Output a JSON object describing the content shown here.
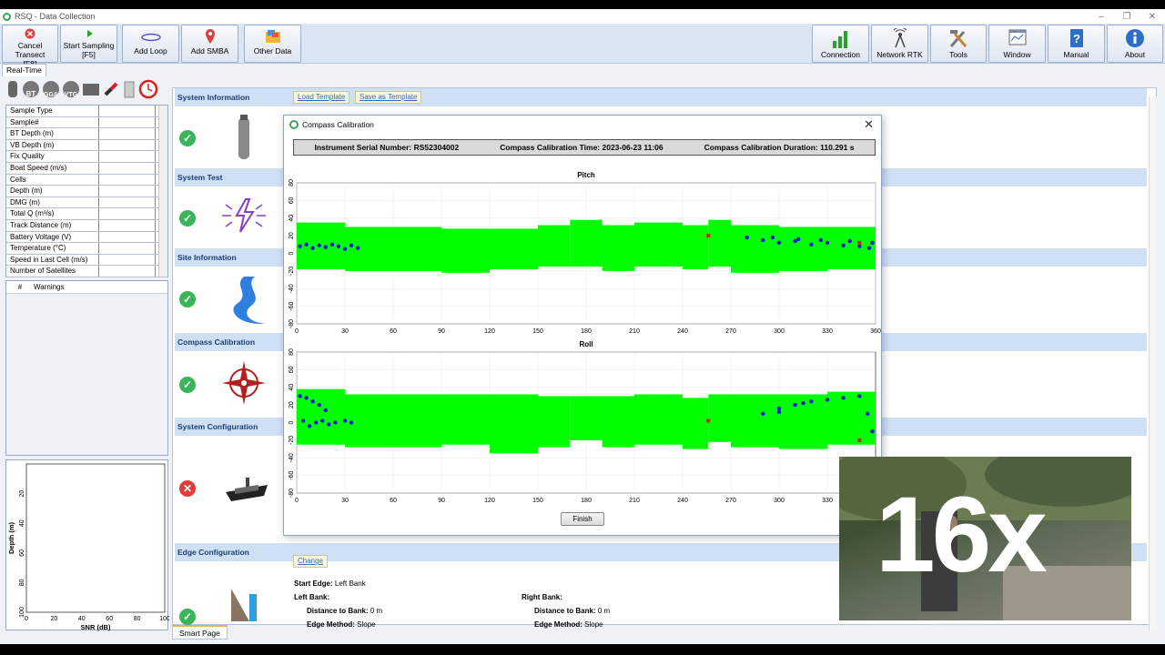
{
  "window": {
    "title": "RSQ - Data Collection"
  },
  "toolbar": {
    "left": [
      {
        "label": "Cancel Transect",
        "sub": "[F8]",
        "icon": "cancel-icon"
      },
      {
        "label": "Start Sampling",
        "sub": "[F5]",
        "icon": "play-icon"
      },
      {
        "label": "Add Loop",
        "sub": "",
        "icon": "loop-icon"
      },
      {
        "label": "Add SMBA",
        "sub": "",
        "icon": "pin-icon"
      },
      {
        "label": "Other Data",
        "sub": "",
        "icon": "folder-icon"
      }
    ],
    "right": [
      {
        "label": "Connection",
        "icon": "signal-bars-icon"
      },
      {
        "label": "Network RTK",
        "icon": "antenna-icon"
      },
      {
        "label": "Tools",
        "icon": "tools-icon"
      },
      {
        "label": "Window",
        "icon": "window-icon"
      },
      {
        "label": "Manual",
        "icon": "manual-icon"
      },
      {
        "label": "About",
        "icon": "info-icon"
      }
    ]
  },
  "tabs": {
    "realtime": "Real-Time",
    "smart_page": "Smart Page"
  },
  "left_icons": [
    "BT",
    "GGA",
    "VTG"
  ],
  "data_table": [
    "Sample Type",
    "Sample#",
    "BT Depth (m)",
    "VB Depth (m)",
    "Fix Quality",
    "Boat Speed (m/s)",
    "Cells",
    "Depth (m)",
    "DMG (m)",
    "Total Q (m³/s)",
    "Track Distance (m)",
    "Battery Voltage (V)",
    "Temperature (°C)",
    "Speed in Last Cell (m/s)",
    "Number of Satellites"
  ],
  "warnings": {
    "col_num": "#",
    "col_label": "Warnings"
  },
  "snr_chart": {
    "xlabel": "SNR (dB)",
    "ylabel": "Depth (m)",
    "xticks": [
      "0",
      "20",
      "40",
      "60",
      "80",
      "100"
    ],
    "yticks": [
      "20",
      "40",
      "60",
      "80",
      "100"
    ]
  },
  "sections": {
    "system_information": "System Information",
    "load_template": "Load Template",
    "save_template": "Save as Template",
    "system_test": "System Test",
    "site_information": "Site Information",
    "compass_calibration": "Compass Calibration",
    "system_configuration": "System Configuration",
    "edge_configuration": "Edge Configuration",
    "change": "Change"
  },
  "edge": {
    "start_edge_label": "Start Edge:",
    "start_edge_value": "Left Bank",
    "left_bank": "Left Bank:",
    "right_bank": "Right Bank:",
    "distance_label": "Distance to Bank:",
    "left_distance": "0 m",
    "right_distance": "0 m",
    "method_label": "Edge Method:",
    "left_method": "Slope",
    "right_method": "Slope"
  },
  "dialog": {
    "title": "Compass Calibration",
    "serial": "Instrument Serial Number: RS52304002",
    "time": "Compass Calibration Time: 2023-06-23 11:06",
    "duration": "Compass Calibration Duration: 110.291 s",
    "finish": "Finish"
  },
  "chart_data": [
    {
      "type": "scatter",
      "title": "Pitch",
      "xlim": [
        0,
        360
      ],
      "ylim": [
        -80,
        80
      ],
      "xticks": [
        0,
        30,
        60,
        90,
        120,
        150,
        180,
        210,
        240,
        270,
        300,
        330,
        360
      ],
      "yticks": [
        80,
        60,
        40,
        20,
        0,
        -20,
        -40,
        -60,
        -80
      ],
      "band_color": "#00ff00",
      "point_color": "#1a1ad6",
      "marker_color": "#d62020",
      "band": [
        [
          0,
          -18,
          35
        ],
        [
          30,
          -20,
          30
        ],
        [
          60,
          -20,
          30
        ],
        [
          90,
          -22,
          28
        ],
        [
          120,
          -18,
          28
        ],
        [
          150,
          -15,
          32
        ],
        [
          170,
          -15,
          38
        ],
        [
          190,
          -20,
          32
        ],
        [
          210,
          -15,
          35
        ],
        [
          240,
          -18,
          32
        ],
        [
          256,
          -15,
          38
        ],
        [
          270,
          -22,
          32
        ],
        [
          300,
          -20,
          30
        ],
        [
          330,
          -18,
          30
        ],
        [
          360,
          -18,
          30
        ]
      ],
      "markers": [
        [
          256,
          20
        ],
        [
          350,
          12
        ]
      ],
      "points": [
        [
          2,
          8
        ],
        [
          6,
          10
        ],
        [
          10,
          6
        ],
        [
          14,
          9
        ],
        [
          18,
          7
        ],
        [
          22,
          10
        ],
        [
          26,
          8
        ],
        [
          30,
          5
        ],
        [
          34,
          9
        ],
        [
          38,
          6
        ],
        [
          280,
          18
        ],
        [
          290,
          15
        ],
        [
          300,
          12
        ],
        [
          310,
          14
        ],
        [
          320,
          10
        ],
        [
          330,
          12
        ],
        [
          340,
          9
        ],
        [
          350,
          8
        ],
        [
          356,
          6
        ],
        [
          358,
          12
        ],
        [
          296,
          18
        ],
        [
          312,
          16
        ],
        [
          326,
          15
        ],
        [
          344,
          14
        ]
      ]
    },
    {
      "type": "scatter",
      "title": "Roll",
      "xlim": [
        0,
        360
      ],
      "ylim": [
        -80,
        80
      ],
      "xticks": [
        0,
        30,
        60,
        90,
        120,
        150,
        180,
        210,
        240,
        270,
        300,
        330
      ],
      "yticks": [
        80,
        60,
        40,
        20,
        0,
        -20,
        -40,
        -60,
        -80
      ],
      "band_color": "#00ff00",
      "point_color": "#1a1ad6",
      "marker_color": "#d62020",
      "band": [
        [
          0,
          -25,
          38
        ],
        [
          30,
          -28,
          32
        ],
        [
          60,
          -28,
          32
        ],
        [
          90,
          -25,
          32
        ],
        [
          120,
          -35,
          32
        ],
        [
          150,
          -28,
          30
        ],
        [
          170,
          -20,
          30
        ],
        [
          190,
          -28,
          30
        ],
        [
          210,
          -25,
          32
        ],
        [
          240,
          -30,
          28
        ],
        [
          256,
          -22,
          32
        ],
        [
          270,
          -28,
          32
        ],
        [
          300,
          -30,
          32
        ],
        [
          330,
          -25,
          35
        ],
        [
          360,
          -25,
          35
        ]
      ],
      "markers": [
        [
          256,
          2
        ],
        [
          350,
          -20
        ]
      ],
      "points": [
        [
          2,
          30
        ],
        [
          6,
          28
        ],
        [
          10,
          24
        ],
        [
          14,
          20
        ],
        [
          18,
          14
        ],
        [
          4,
          2
        ],
        [
          8,
          -4
        ],
        [
          12,
          0
        ],
        [
          16,
          2
        ],
        [
          20,
          -2
        ],
        [
          24,
          0
        ],
        [
          30,
          2
        ],
        [
          34,
          0
        ],
        [
          290,
          10
        ],
        [
          300,
          16
        ],
        [
          310,
          20
        ],
        [
          320,
          24
        ],
        [
          330,
          26
        ],
        [
          340,
          28
        ],
        [
          350,
          30
        ],
        [
          355,
          10
        ],
        [
          358,
          -10
        ],
        [
          300,
          12
        ],
        [
          315,
          22
        ]
      ]
    }
  ]
}
